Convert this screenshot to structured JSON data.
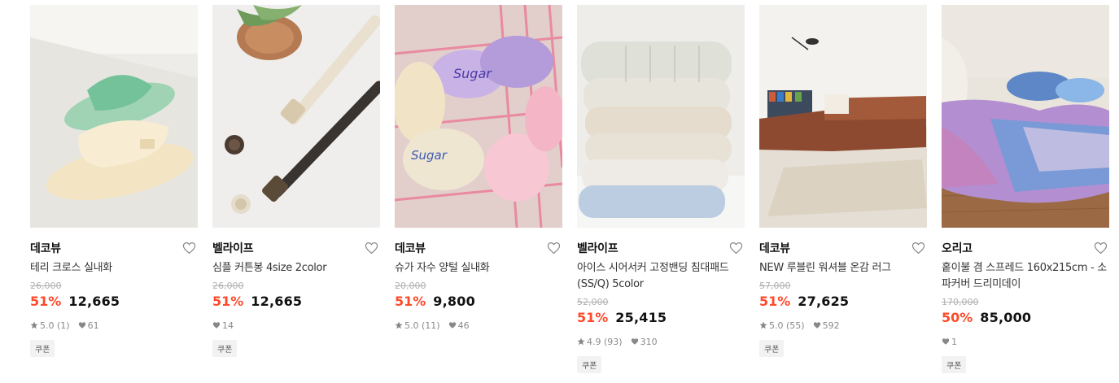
{
  "products": [
    {
      "brand": "데코뷰",
      "name": "테리 크로스 실내화",
      "original_price": "26,000",
      "discount": "51%",
      "price": "12,665",
      "rating": "5.0",
      "reviews": "(1)",
      "likes": "61",
      "coupon": "쿠폰"
    },
    {
      "brand": "벨라이프",
      "name": "심플 커튼봉 4size 2color",
      "original_price": "26,000",
      "discount": "51%",
      "price": "12,665",
      "rating": "",
      "reviews": "",
      "likes": "14",
      "coupon": "쿠폰"
    },
    {
      "brand": "데코뷰",
      "name": "슈가 자수 양털 실내화",
      "original_price": "20,000",
      "discount": "51%",
      "price": "9,800",
      "rating": "5.0",
      "reviews": "(11)",
      "likes": "46",
      "coupon": ""
    },
    {
      "brand": "벨라이프",
      "name": "아이스 시어서커 고정밴딩 침대패드 (SS/Q) 5color",
      "original_price": "52,000",
      "discount": "51%",
      "price": "25,415",
      "rating": "4.9",
      "reviews": "(93)",
      "likes": "310",
      "coupon": "쿠폰"
    },
    {
      "brand": "데코뷰",
      "name": "NEW 루블린 워셔블 온감 러그",
      "original_price": "57,000",
      "discount": "51%",
      "price": "27,625",
      "rating": "5.0",
      "reviews": "(55)",
      "likes": "592",
      "coupon": "쿠폰"
    },
    {
      "brand": "오리고",
      "name": "홑이불 겸 스프레드 160x215cm - 소파커버 드리미데이",
      "original_price": "170,000",
      "discount": "50%",
      "price": "85,000",
      "rating": "",
      "reviews": "",
      "likes": "1",
      "coupon": "쿠폰"
    }
  ],
  "colors": {
    "discount": "#ff4a2a",
    "original_price": "#b0b0b0",
    "coupon_bg": "#f2f2f2"
  },
  "icons": {
    "wishlist": "heart-outline-icon",
    "rating": "star-icon",
    "likes": "heart-filled-icon"
  }
}
